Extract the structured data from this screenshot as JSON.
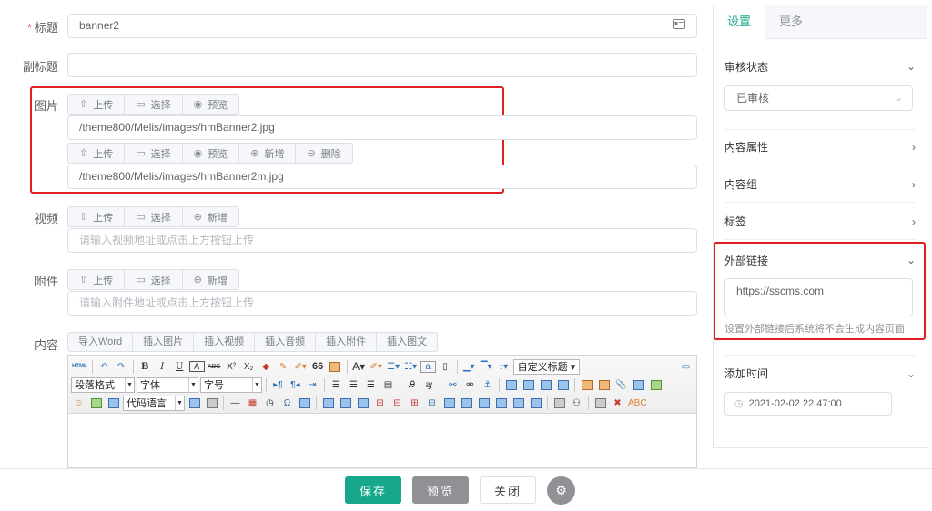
{
  "form": {
    "title": {
      "required_mark": "*",
      "label": "标题",
      "value": "banner2",
      "icon": "id-card-icon"
    },
    "subtitle": {
      "label": "副标题",
      "value": ""
    },
    "image": {
      "label": "图片",
      "toolbar1": [
        "上传",
        "选择",
        "预览"
      ],
      "value1": "/theme800/Melis/images/hmBanner2.jpg",
      "toolbar2": [
        "上传",
        "选择",
        "预览",
        "新增",
        "删除"
      ],
      "value2": "/theme800/Melis/images/hmBanner2m.jpg"
    },
    "video": {
      "label": "视频",
      "toolbar": [
        "上传",
        "选择",
        "新增"
      ],
      "placeholder": "请输入视频地址或点击上方按钮上传"
    },
    "attachment": {
      "label": "附件",
      "toolbar": [
        "上传",
        "选择",
        "新增"
      ],
      "placeholder": "请输入附件地址或点击上方按钮上传"
    },
    "content": {
      "label": "内容",
      "insert_buttons": [
        "导入Word",
        "插入图片",
        "插入视频",
        "插入音频",
        "插入附件",
        "插入图文"
      ],
      "editor": {
        "html_label": "HTML",
        "custom_title": "自定义标题",
        "paragraph_format": "段落格式",
        "font_family": "字体",
        "font_size": "字号",
        "code_language": "代码语言",
        "glyph_letters": {
          "bold": "B",
          "italic": "I",
          "underline": "U",
          "strike": "ABC",
          "sup": "X²",
          "sub": "X₂",
          "quote": "66",
          "font_color": "A"
        }
      }
    }
  },
  "footer": {
    "save": "保存",
    "preview": "预览",
    "close": "关闭",
    "gear_icon": "gear-icon"
  },
  "sidebar": {
    "tabs": [
      "设置",
      "更多"
    ],
    "review": {
      "label": "审核状态",
      "value": "已审核"
    },
    "content_attr": "内容属性",
    "content_group": "内容组",
    "tags": "标签",
    "external_link": {
      "label": "外部链接",
      "value": "https://sscms.com",
      "hint": "设置外部链接后系统将不会生成内容页面"
    },
    "add_time": {
      "label": "添加时间",
      "value": "2021-02-02 22:47:00"
    }
  },
  "colors": {
    "primary": "#17a88c",
    "highlight": "#e02020",
    "preview_btn": "#8f9195"
  }
}
